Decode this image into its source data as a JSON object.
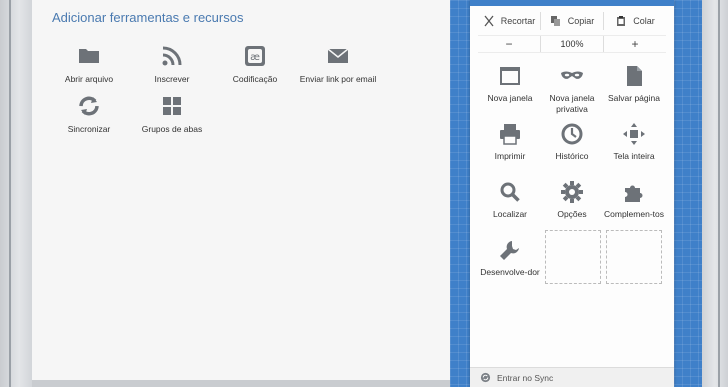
{
  "palette": {
    "title": "Adicionar ferramentas e recursos",
    "items": [
      {
        "label": "Abrir arquivo",
        "icon": "folder-icon"
      },
      {
        "label": "Inscrever",
        "icon": "rss-icon"
      },
      {
        "label": "Codificação",
        "icon": "encoding-icon"
      },
      {
        "label": "Enviar link por email",
        "icon": "email-icon"
      },
      {
        "label": "Sincronizar",
        "icon": "sync-icon"
      },
      {
        "label": "Grupos de abas",
        "icon": "tab-groups-icon"
      }
    ]
  },
  "menu": {
    "edit": {
      "cut": "Recortar",
      "copy": "Copiar",
      "paste": "Colar"
    },
    "zoom": {
      "out": "−",
      "level": "100%",
      "in": "+"
    },
    "tiles": [
      {
        "label": "Nova janela",
        "icon": "window-icon"
      },
      {
        "label": "Nova janela privativa",
        "icon": "mask-icon"
      },
      {
        "label": "Salvar página",
        "icon": "save-page-icon"
      },
      {
        "label": "Imprimir",
        "icon": "printer-icon"
      },
      {
        "label": "Histórico",
        "icon": "clock-icon"
      },
      {
        "label": "Tela inteira",
        "icon": "fullscreen-icon"
      },
      {
        "label": "Localizar",
        "icon": "search-icon"
      },
      {
        "label": "Opções",
        "icon": "gear-icon"
      },
      {
        "label": "Complemen-tos",
        "icon": "puzzle-icon"
      },
      {
        "label": "Desenvolve-dor",
        "icon": "wrench-icon"
      }
    ],
    "sync": "Entrar no Sync"
  },
  "colors": {
    "accent_blue": "#3f80c9",
    "title_blue": "#4a7ab0",
    "icon_gray": "#6d7278"
  }
}
